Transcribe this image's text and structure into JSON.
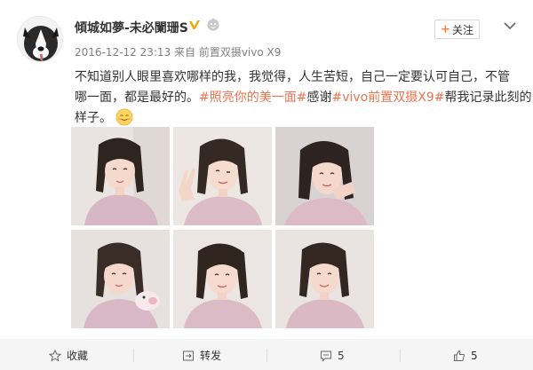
{
  "post": {
    "username": "傾城如夢-未必闌珊S",
    "timestamp": "2016-12-12 23:13",
    "source_prefix": "来自",
    "source": "前置双摄vivo X9",
    "follow_label": "关注",
    "follow_plus": "+",
    "text": {
      "line1": "不知道别人眼里喜欢哪样的我，我觉得，人生苦短，自己一定要认可自己，不管",
      "line2_pre": "哪一面，都是最好的。",
      "topic1": "#照亮你的美一面#",
      "line2_mid": "感谢",
      "topic2": "#vivo前置双摄X9#",
      "line2_post": "帮我记录此刻的",
      "line3": "样子。"
    },
    "photos_count": 6
  },
  "footer": {
    "favorite_label": "收藏",
    "repost_label": "转发",
    "comment_count": "5",
    "like_count": "5"
  },
  "colors": {
    "topic": "#eb7350",
    "accent_orange": "#fa7d3c",
    "verified_badge": "#f0a800"
  }
}
